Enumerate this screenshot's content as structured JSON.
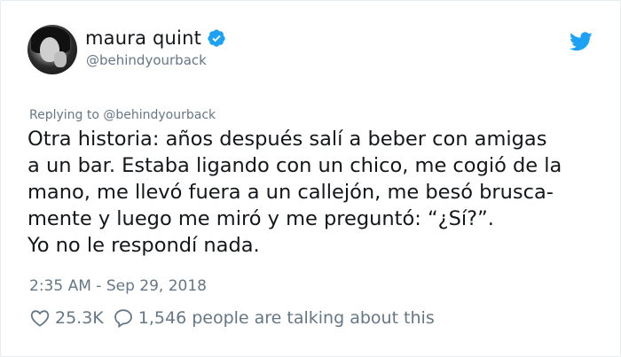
{
  "user": {
    "display_name": "maura quint",
    "handle": "@behindyourback",
    "avatar_icon": "avatar-photo",
    "verified_icon": "verified-badge-icon"
  },
  "tweet": {
    "replying_to": "Replying to @behindyourback",
    "lines": [
      "Otra historia: años después salí a beber con amigas",
      "a un bar. Estaba ligando con un chico, me cogió de la",
      "mano, me llevó fuera a un callejón, me besó brusca-",
      "mente y luego me miró y me preguntó: “¿Sí?”.",
      "Yo no le respondí nada."
    ],
    "timestamp": "2:35 AM - Sep 29, 2018"
  },
  "actions": {
    "likes": "25.3K",
    "talking": "1,546 people are talking about this"
  },
  "colors": {
    "twitter_blue": "#1da1f2",
    "secondary_text": "#657786",
    "primary_text": "#14171a"
  }
}
